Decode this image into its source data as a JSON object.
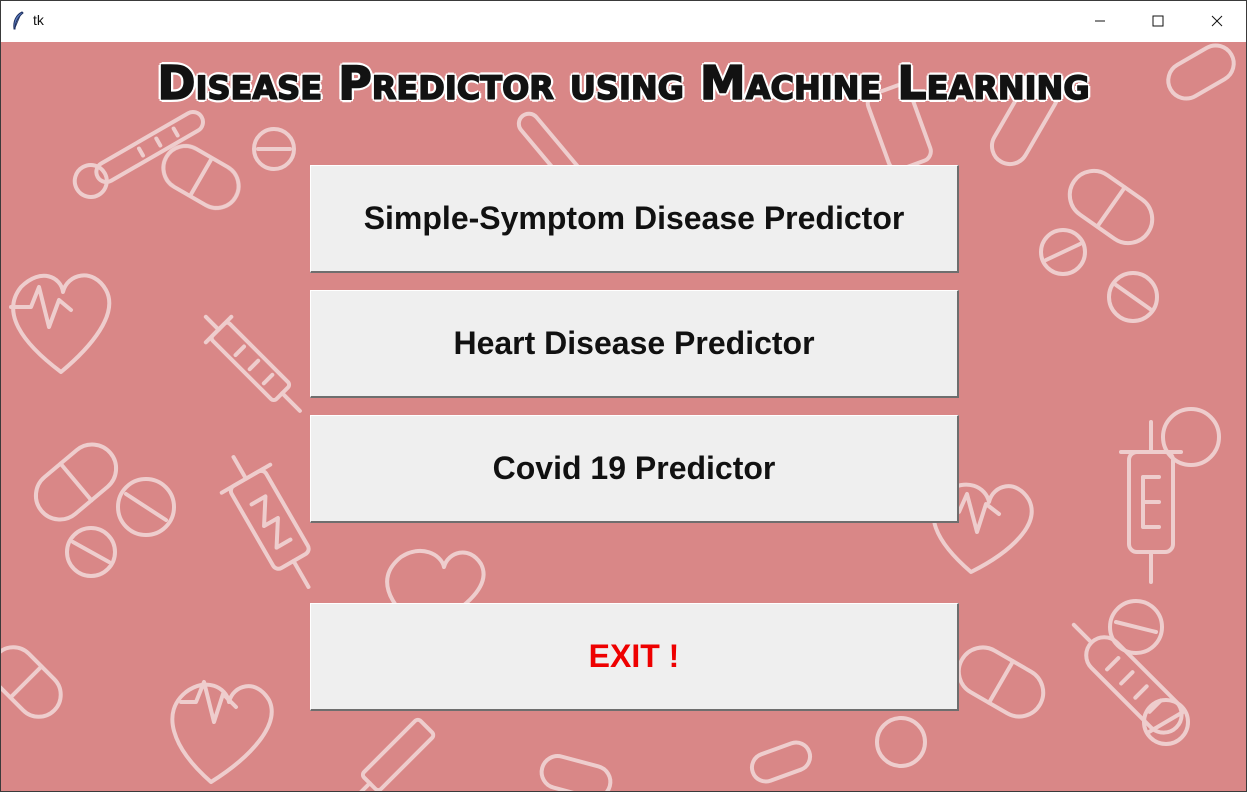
{
  "window": {
    "title": "tk",
    "controls": {
      "minimize_icon": "minimize-icon",
      "maximize_icon": "maximize-icon",
      "close_icon": "close-icon"
    }
  },
  "app": {
    "title": "Disease Predictor using Machine Learning",
    "background_color": "#d98787",
    "buttons": [
      {
        "label": "Simple-Symptom Disease Predictor",
        "color": "#111111"
      },
      {
        "label": "Heart Disease Predictor",
        "color": "#111111"
      },
      {
        "label": "Covid 19 Predictor",
        "color": "#111111"
      },
      {
        "label": "EXIT !",
        "color": "#ee0000"
      }
    ]
  }
}
